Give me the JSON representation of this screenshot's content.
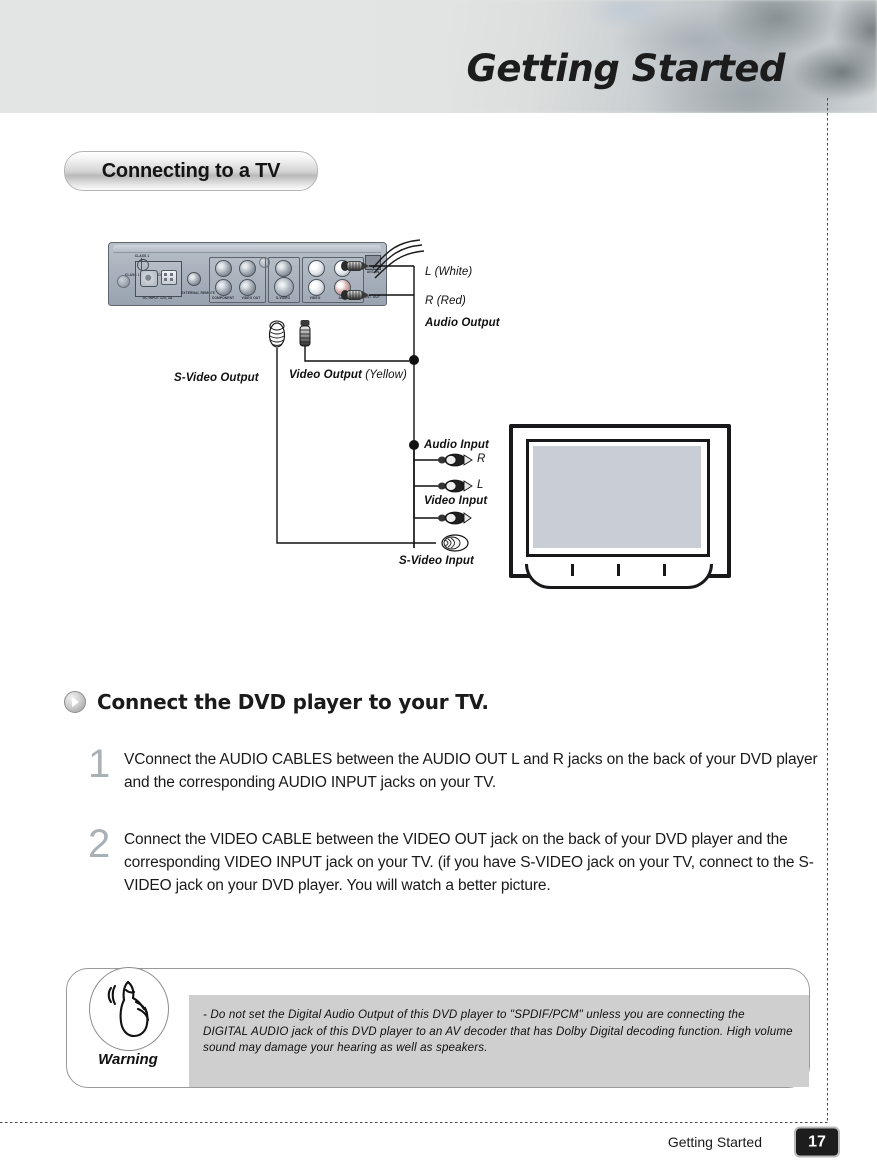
{
  "header": {
    "title": "Getting Started"
  },
  "section": {
    "pill_label": "Connecting to a TV",
    "heading": "Connect the DVD player to your TV."
  },
  "diagram": {
    "labels": {
      "l_white": "L (White)",
      "r_red": "R (Red)",
      "audio_output": "Audio Output",
      "s_video_output": "S-Video Output",
      "video_output": "Video Output",
      "video_output_color": "(Yellow)",
      "audio_input": "Audio Input",
      "input_r": "R",
      "input_l": "L",
      "video_input": "Video Input",
      "s_video_input": "S-Video Input"
    },
    "panel_ports": [
      {
        "id": "dc-input",
        "text": "DC INPUT 12V, 3A"
      },
      {
        "id": "external-remote",
        "text": "EXTERNAL REMOTE"
      },
      {
        "id": "component",
        "text": "COMPONENT"
      },
      {
        "id": "video-out",
        "text": "VIDEO OUT"
      },
      {
        "id": "s-video",
        "text": "S-VIDEO"
      },
      {
        "id": "video",
        "text": "VIDEO"
      },
      {
        "id": "audio",
        "text": "AUDIO"
      },
      {
        "id": "ant-in",
        "text": "ANT. IN"
      },
      {
        "id": "ant-out",
        "text": "ANT. OUT"
      },
      {
        "id": "laser",
        "text": "CLASS 1 LASER PRODUCT"
      }
    ]
  },
  "steps": [
    {
      "number": "1",
      "text": "VConnect the AUDIO CABLES between the AUDIO OUT L and R jacks on the back of your DVD player and the corresponding AUDIO INPUT jacks on your TV."
    },
    {
      "number": "2",
      "text": "Connect the VIDEO CABLE between the VIDEO OUT jack on the back of your DVD player and the corresponding VIDEO INPUT jack on your TV. (if you have S-VIDEO jack on your TV, connect to the S-VIDEO jack on your DVD player. You will watch a better picture."
    }
  ],
  "warning": {
    "label": "Warning",
    "text": "- Do not set the Digital Audio Output of this DVD player to \"SPDIF/PCM\"  unless you are connecting the DIGITAL AUDIO jack of this DVD player to an AV decoder that has Dolby Digital decoding function. High volume sound may damage your hearing as well as speakers."
  },
  "footer": {
    "section_name": "Getting Started",
    "page_number": "17"
  }
}
